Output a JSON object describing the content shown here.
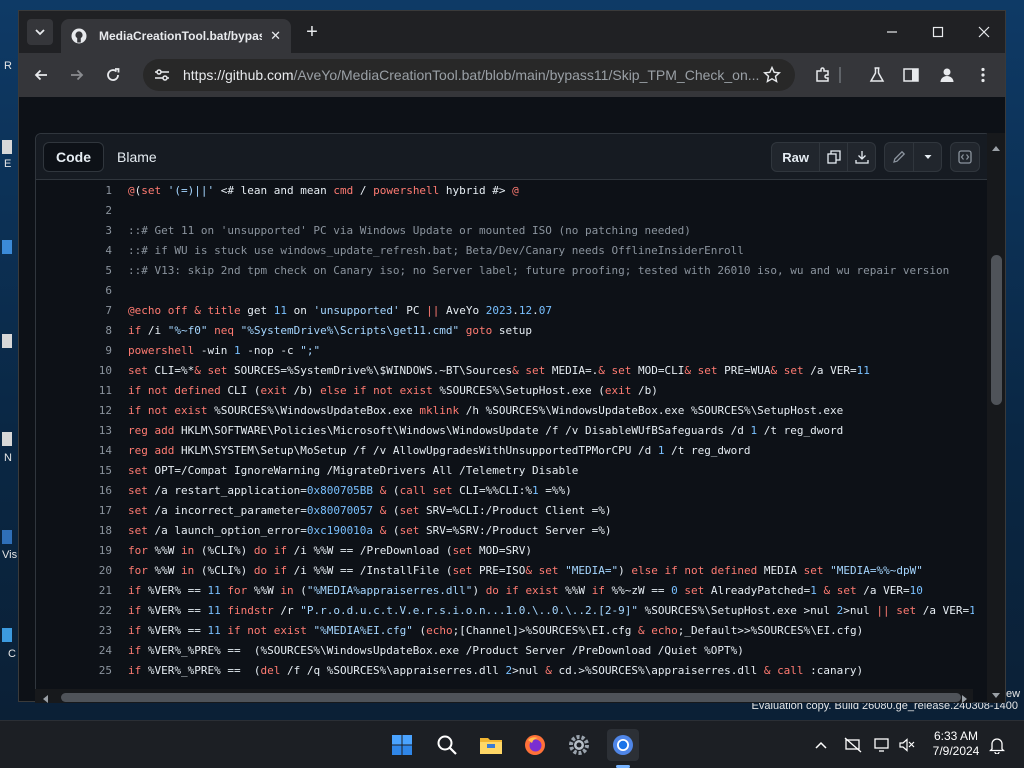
{
  "browser": {
    "tab_title": "MediaCreationTool.bat/bypass",
    "url_host": "https://github.com",
    "url_path": "/AveYo/MediaCreationTool.bat/blob/main/bypass11/Skip_TPM_Check_on..."
  },
  "code_view": {
    "tab_code": "Code",
    "tab_blame": "Blame",
    "raw_label": "Raw",
    "lines": [
      {
        "n": "1",
        "t": "@(set '(=)||' <# lean and mean cmd / powershell hybrid #> @'"
      },
      {
        "n": "2",
        "t": ""
      },
      {
        "n": "3",
        "t": "::# Get 11 on 'unsupported' PC via Windows Update or mounted ISO (no patching needed)"
      },
      {
        "n": "4",
        "t": "::# if WU is stuck use windows_update_refresh.bat; Beta/Dev/Canary needs OfflineInsiderEnroll"
      },
      {
        "n": "5",
        "t": "::# V13: skip 2nd tpm check on Canary iso; no Server label; future proofing; tested with 26010 iso, wu and wu repair version"
      },
      {
        "n": "6",
        "t": ""
      },
      {
        "n": "7",
        "t": "@echo off & title get 11 on 'unsupported' PC || AveYo 2023.12.07"
      },
      {
        "n": "8",
        "t": "if /i \"%~f0\" neq \"%SystemDrive%\\Scripts\\get11.cmd\" goto setup"
      },
      {
        "n": "9",
        "t": "powershell -win 1 -nop -c \";\""
      },
      {
        "n": "10",
        "t": "set CLI=%*& set SOURCES=%SystemDrive%\\$WINDOWS.~BT\\Sources& set MEDIA=.& set MOD=CLI& set PRE=WUA& set /a VER=11"
      },
      {
        "n": "11",
        "t": "if not defined CLI (exit /b) else if not exist %SOURCES%\\SetupHost.exe (exit /b)"
      },
      {
        "n": "12",
        "t": "if not exist %SOURCES%\\WindowsUpdateBox.exe mklink /h %SOURCES%\\WindowsUpdateBox.exe %SOURCES%\\SetupHost.exe"
      },
      {
        "n": "13",
        "t": "reg add HKLM\\SOFTWARE\\Policies\\Microsoft\\Windows\\WindowsUpdate /f /v DisableWUfBSafeguards /d 1 /t reg_dword"
      },
      {
        "n": "14",
        "t": "reg add HKLM\\SYSTEM\\Setup\\MoSetup /f /v AllowUpgradesWithUnsupportedTPMorCPU /d 1 /t reg_dword"
      },
      {
        "n": "15",
        "t": "set OPT=/Compat IgnoreWarning /MigrateDrivers All /Telemetry Disable"
      },
      {
        "n": "16",
        "t": "set /a restart_application=0x800705BB & (call set CLI=%%CLI:%1 =%%)"
      },
      {
        "n": "17",
        "t": "set /a incorrect_parameter=0x80070057 & (set SRV=%CLI:/Product Client =%)"
      },
      {
        "n": "18",
        "t": "set /a launch_option_error=0xc190010a & (set SRV=%SRV:/Product Server =%)"
      },
      {
        "n": "19",
        "t": "for %%W in (%CLI%) do if /i %%W == /PreDownload (set MOD=SRV)"
      },
      {
        "n": "20",
        "t": "for %%W in (%CLI%) do if /i %%W == /InstallFile (set PRE=ISO& set \"MEDIA=\") else if not defined MEDIA set \"MEDIA=%%~dpW\""
      },
      {
        "n": "21",
        "t": "if %VER% == 11 for %%W in (\"%MEDIA%appraiserres.dll\") do if exist %%W if %%~zW == 0 set AlreadyPatched=1 & set /a VER=10"
      },
      {
        "n": "22",
        "t": "if %VER% == 11 findstr /r \"P.r.o.d.u.c.t.V.e.r.s.i.o.n...1.0.\\..0.\\..2.[2-9]\" %SOURCES%\\SetupHost.exe >nul 2>nul || set /a VER=1"
      },
      {
        "n": "23",
        "t": "if %VER% == 11 if not exist \"%MEDIA%EI.cfg\" (echo;[Channel]>%SOURCES%\\EI.cfg & echo;_Default>>%SOURCES%\\EI.cfg)"
      },
      {
        "n": "24",
        "t": "if %VER%_%PRE% == 11_ISO (%SOURCES%\\WindowsUpdateBox.exe /Product Server /PreDownload /Quiet %OPT%)"
      },
      {
        "n": "25",
        "t": "if %VER%_%PRE% == 11_ISO (del /f /q %SOURCES%\\appraiserres.dll 2>nul & cd.>%SOURCES%\\appraiserres.dll & call :canary)"
      }
    ]
  },
  "desktop": {
    "watermark": "Evaluation copy. Build 26080.ge_release.240308-1400",
    "edge_labels": [
      "R",
      "E",
      "N",
      "Vis",
      "C",
      "ew"
    ]
  },
  "taskbar": {
    "time": "6:33 AM",
    "date": "7/9/2024"
  },
  "colors": {
    "accent": "#ff7b72",
    "string": "#a5d6ff",
    "comment": "#8b949e",
    "number": "#79c0ff"
  }
}
